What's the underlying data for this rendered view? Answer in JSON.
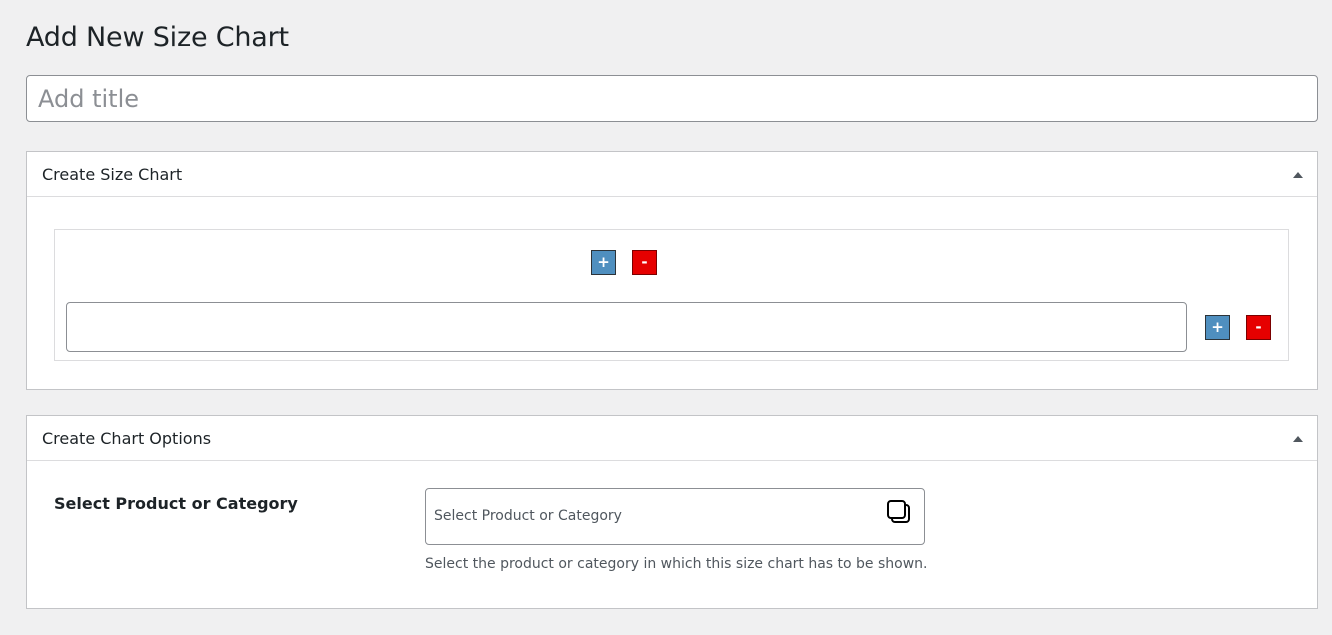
{
  "page": {
    "title": "Add New Size Chart",
    "title_placeholder": "Add title"
  },
  "size_chart_box": {
    "title": "Create Size Chart",
    "add_column_label": "+",
    "remove_column_label": "-",
    "add_row_label": "+",
    "remove_row_label": "-",
    "cell_value": ""
  },
  "chart_options_box": {
    "title": "Create Chart Options",
    "select_label": "Select Product or Category",
    "select_placeholder": "Select Product or Category",
    "help_text": "Select the product or category in which this size chart has to be shown."
  },
  "colors": {
    "plus_button": "#4f8fbf",
    "minus_button": "#e60000",
    "background": "#f0f0f1"
  }
}
